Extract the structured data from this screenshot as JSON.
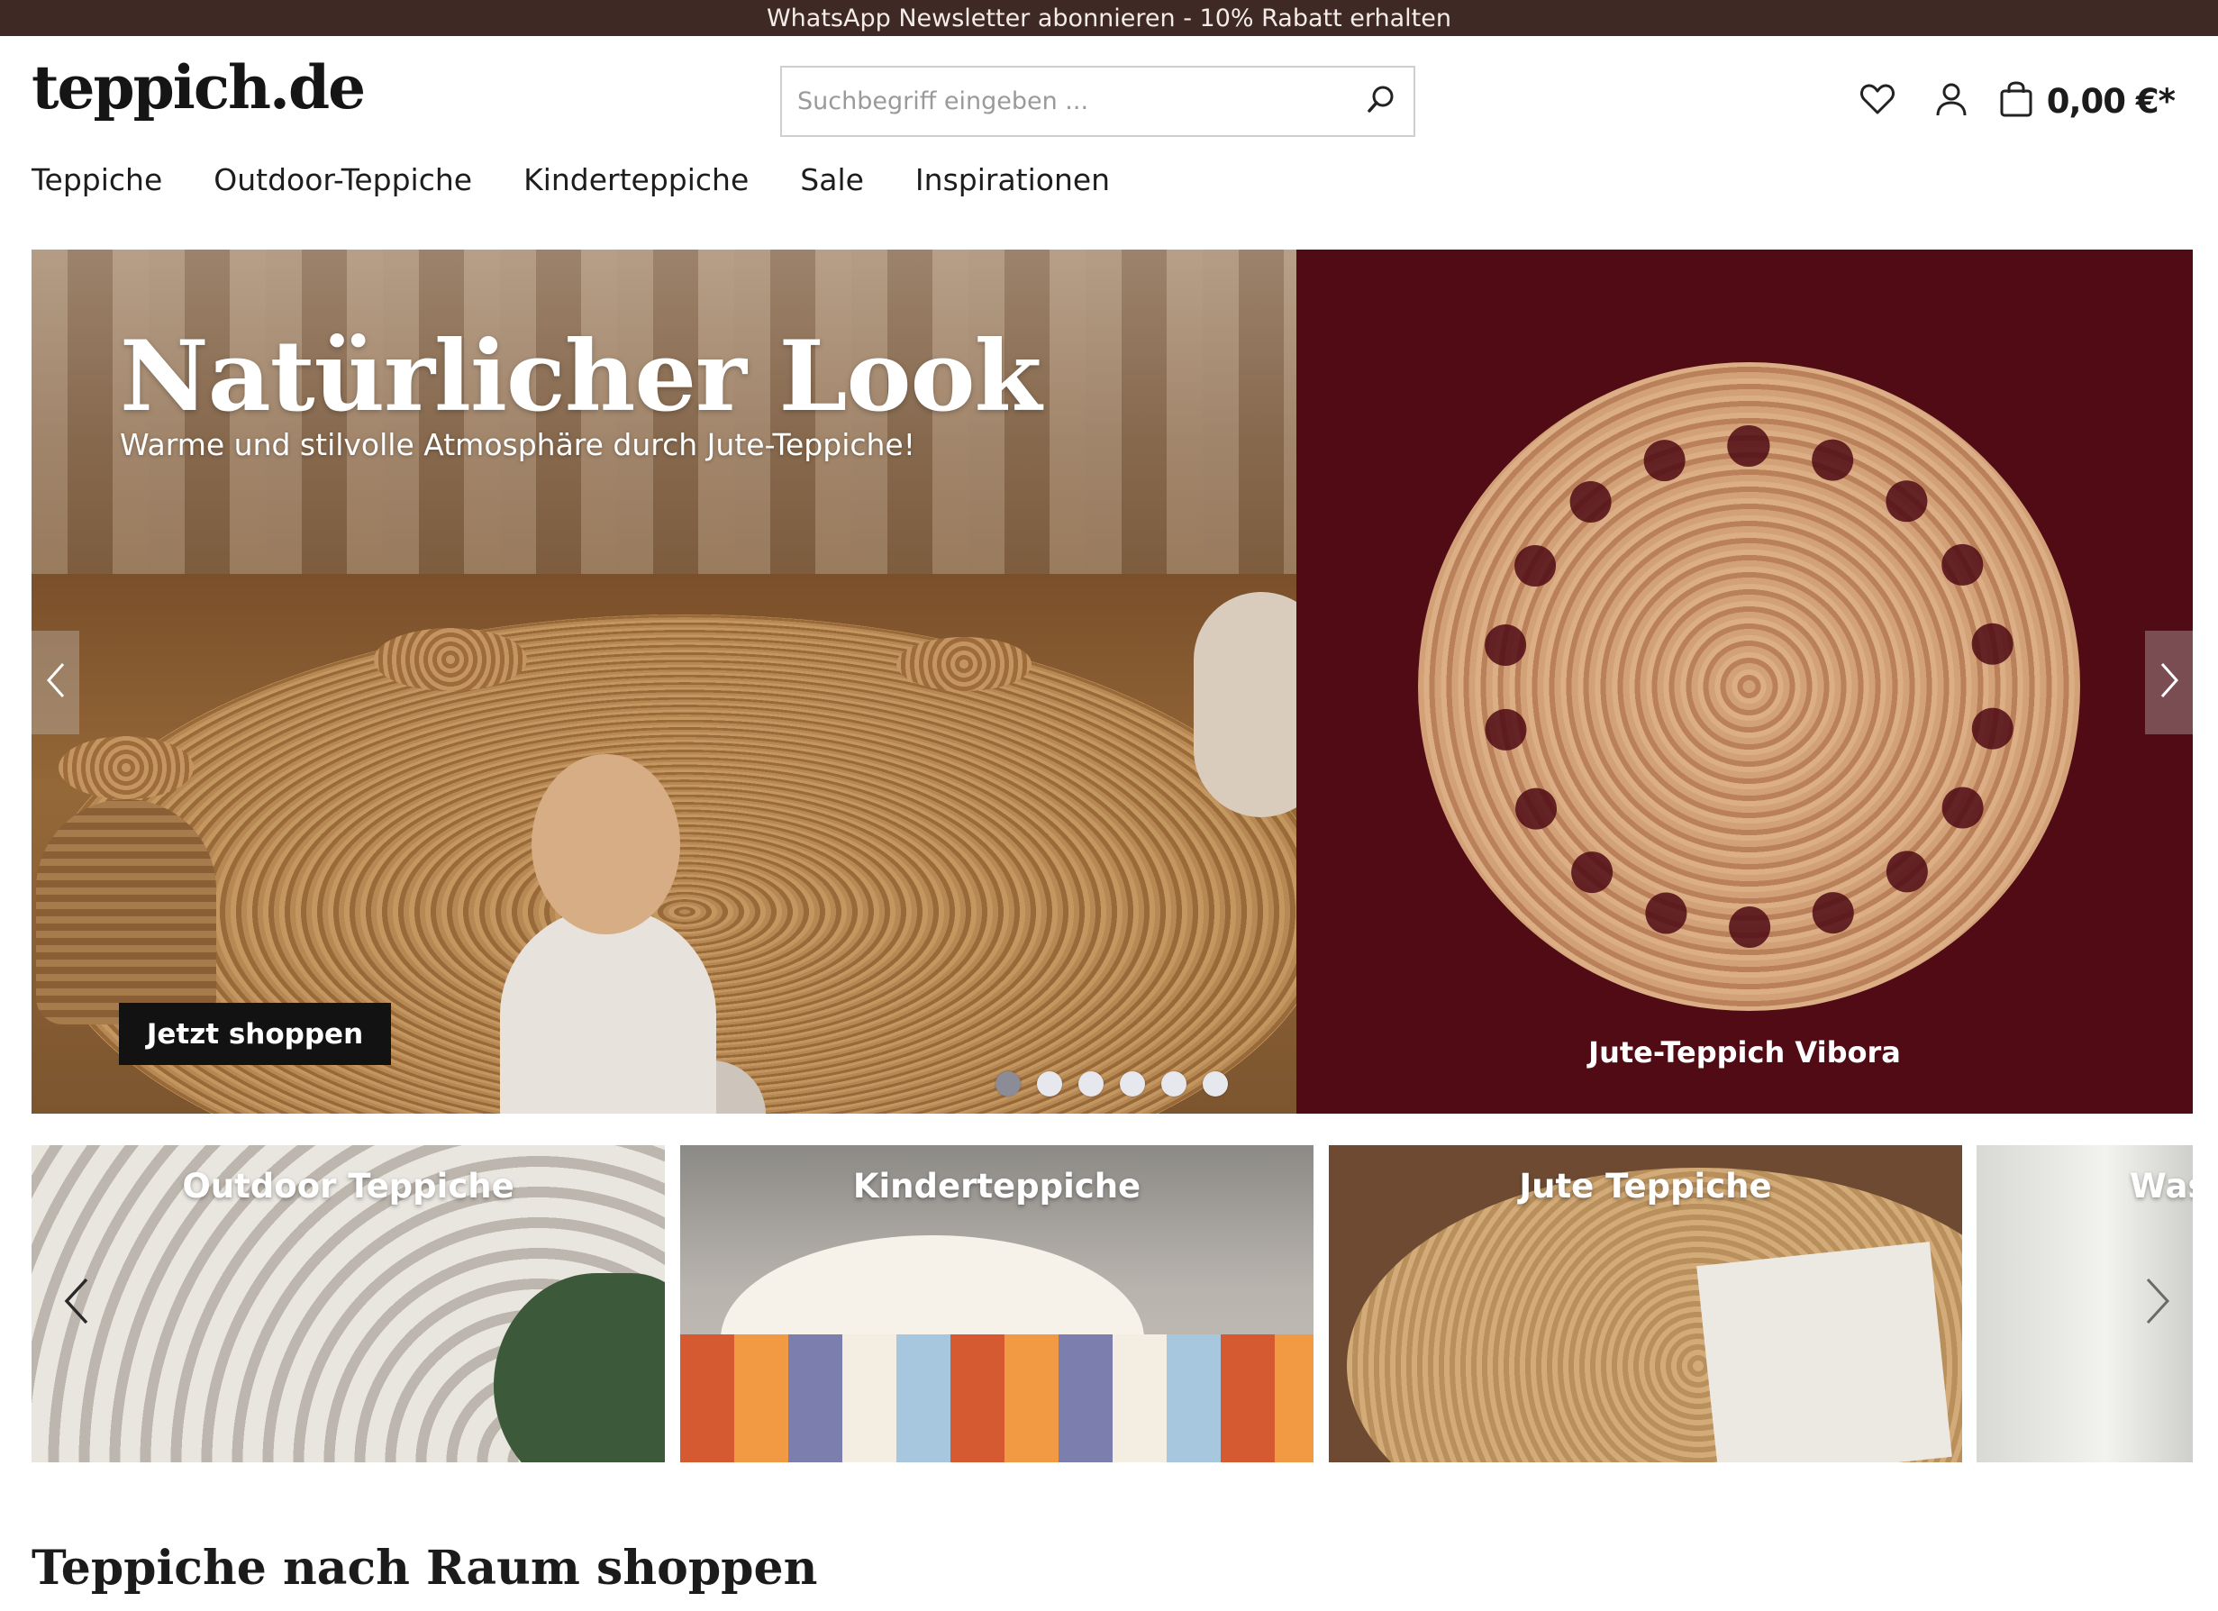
{
  "topbar": {
    "text": "WhatsApp Newsletter abonnieren - 10% Rabatt erhalten"
  },
  "header": {
    "logo": "teppich.de",
    "search": {
      "placeholder": "Suchbegriff eingeben ...",
      "value": "",
      "icon": "search-icon"
    },
    "icons": {
      "wishlist": "heart-icon",
      "account": "user-icon",
      "cart": "shopping-bag-icon"
    },
    "cart_total": "0,00 €*"
  },
  "nav": {
    "items": [
      {
        "label": "Teppiche"
      },
      {
        "label": "Outdoor-Teppiche"
      },
      {
        "label": "Kinderteppiche"
      },
      {
        "label": "Sale"
      },
      {
        "label": "Inspirationen"
      }
    ]
  },
  "hero": {
    "title": "Natürlicher Look",
    "subtitle": "Warme und stilvolle Atmosphäre durch Jute-Teppiche!",
    "cta": "Jetzt shoppen",
    "product_caption": "Jute-Teppich Vibora",
    "slides_count": 6,
    "active_slide": 1,
    "colors": {
      "right_panel": "#500b15"
    }
  },
  "categories": {
    "items": [
      {
        "label": "Outdoor Teppiche"
      },
      {
        "label": "Kinderteppiche"
      },
      {
        "label": "Jute Teppiche"
      },
      {
        "label": "Was"
      }
    ]
  },
  "sections": {
    "room_title": "Teppiche nach Raum shoppen"
  },
  "colors": {
    "topbar": "#3e2925",
    "accent_dark": "#121212"
  }
}
